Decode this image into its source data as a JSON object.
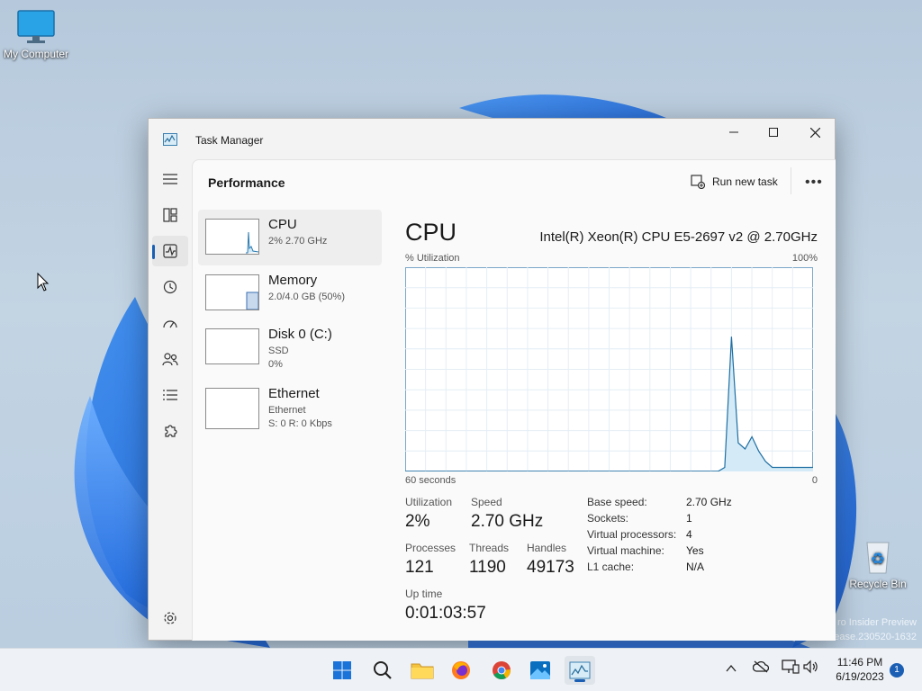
{
  "desktop": {
    "icons": [
      {
        "label": "My Computer"
      },
      {
        "label": "Recycle Bin"
      }
    ],
    "watermark": {
      "line1": "ro Insider Preview",
      "line2": "ease.230520-1632"
    }
  },
  "window": {
    "title": "Task Manager",
    "controls": {
      "minimize": "—",
      "maximize": "☐",
      "close": "✕"
    }
  },
  "nav": {
    "items": [
      "Menu",
      "Processes",
      "Performance",
      "App history",
      "Startup apps",
      "Users",
      "Details",
      "Services",
      "Settings"
    ],
    "active": "Performance"
  },
  "page": {
    "title": "Performance",
    "run_new_task": "Run new task",
    "more": "•••"
  },
  "perf_list": [
    {
      "name": "CPU",
      "sub1": "2% 2.70 GHz",
      "sub2": "",
      "selected": true
    },
    {
      "name": "Memory",
      "sub1": "2.0/4.0 GB (50%)",
      "sub2": "",
      "selected": false
    },
    {
      "name": "Disk 0 (C:)",
      "sub1": "SSD",
      "sub2": "0%",
      "selected": false
    },
    {
      "name": "Ethernet",
      "sub1": "Ethernet",
      "sub2": "S: 0 R: 0 Kbps",
      "selected": false
    }
  ],
  "cpu": {
    "title": "CPU",
    "model": "Intel(R) Xeon(R) CPU E5-2697 v2 @ 2.70GHz",
    "graph_label": "% Utilization",
    "graph_max": "100%",
    "graph_time": "60 seconds",
    "graph_min": "0",
    "stats": {
      "utilization_label": "Utilization",
      "utilization": "2%",
      "speed_label": "Speed",
      "speed": "2.70 GHz",
      "processes_label": "Processes",
      "processes": "121",
      "threads_label": "Threads",
      "threads": "1190",
      "handles_label": "Handles",
      "handles": "49173",
      "uptime_label": "Up time",
      "uptime": "0:01:03:57"
    },
    "details": [
      {
        "k": "Base speed:",
        "v": "2.70 GHz"
      },
      {
        "k": "Sockets:",
        "v": "1"
      },
      {
        "k": "Virtual processors:",
        "v": "4"
      },
      {
        "k": "Virtual machine:",
        "v": "Yes"
      },
      {
        "k": "L1 cache:",
        "v": "N/A"
      }
    ]
  },
  "chart_data": {
    "type": "area",
    "x": [
      60,
      59,
      58,
      57,
      56,
      55,
      54,
      53,
      52,
      51,
      50,
      49,
      48,
      47,
      46,
      45,
      44,
      43,
      42,
      41,
      40,
      39,
      38,
      37,
      36,
      35,
      34,
      33,
      32,
      31,
      30,
      29,
      28,
      27,
      26,
      25,
      24,
      23,
      22,
      21,
      20,
      19,
      18,
      17,
      16,
      15,
      14,
      13,
      12,
      11,
      10,
      9,
      8,
      7,
      6,
      5,
      4,
      3,
      2,
      1,
      0
    ],
    "values": [
      0,
      0,
      0,
      0,
      0,
      0,
      0,
      0,
      0,
      0,
      0,
      0,
      0,
      0,
      0,
      0,
      0,
      0,
      0,
      0,
      0,
      0,
      0,
      0,
      0,
      0,
      0,
      0,
      0,
      0,
      0,
      0,
      0,
      0,
      0,
      0,
      0,
      0,
      0,
      0,
      0,
      0,
      0,
      0,
      0,
      0,
      0,
      2,
      66,
      14,
      11,
      17,
      10,
      5,
      2,
      2,
      2,
      2,
      2,
      2,
      2
    ],
    "xlabel": "60 seconds",
    "ylabel": "% Utilization",
    "ylim": [
      0,
      100
    ],
    "grid": true
  },
  "taskbar": {
    "apps": [
      "Start",
      "Search",
      "File Explorer",
      "Firefox",
      "Chrome",
      "Photos",
      "Task Manager"
    ],
    "clock_time": "11:46 PM",
    "clock_date": "6/19/2023",
    "notifications": "1"
  }
}
